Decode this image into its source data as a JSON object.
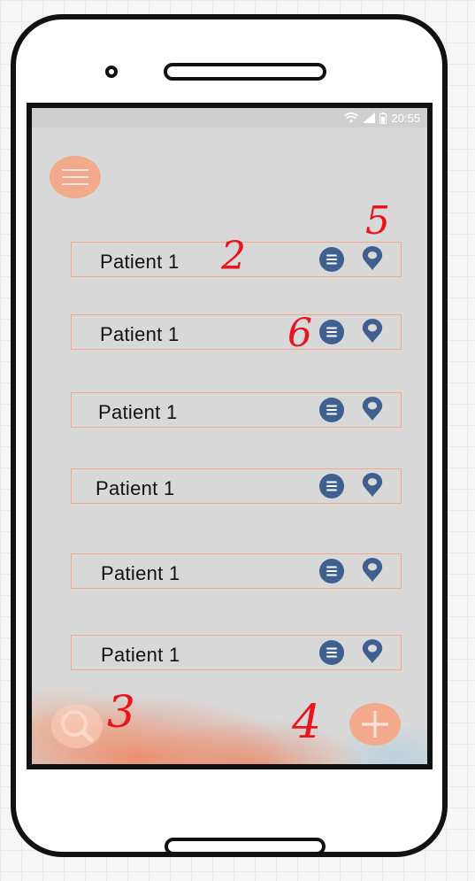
{
  "status_bar": {
    "time": "20:55"
  },
  "patients": [
    {
      "label": "Patient 1"
    },
    {
      "label": "Patient 1"
    },
    {
      "label": "Patient 1"
    },
    {
      "label": "Patient 1"
    },
    {
      "label": "Patient 1"
    },
    {
      "label": "Patient 1"
    }
  ],
  "annotations": {
    "n2": "2",
    "n3": "3",
    "n4": "4",
    "n5": "5",
    "n6": "6"
  },
  "icons": {
    "menu": "hamburger-icon",
    "info": "list-icon",
    "location": "map-pin-icon",
    "search": "search-icon",
    "add": "plus-icon",
    "wifi": "wifi-icon",
    "signal": "signal-icon",
    "battery": "battery-icon"
  },
  "colors": {
    "accent": "#f3a98b",
    "row_border": "#f0a98a",
    "icon_blue": "#3f5f8f",
    "annotation_red": "#e8161c",
    "screen_bg": "#d8d8d8"
  }
}
